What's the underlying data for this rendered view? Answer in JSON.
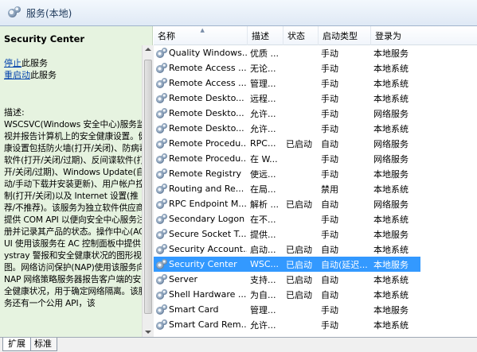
{
  "window": {
    "title": "服务(本地)"
  },
  "left_pane": {
    "service_name": "Security Center",
    "actions": [
      {
        "link": "停止",
        "suffix": "此服务"
      },
      {
        "link": "重启动",
        "suffix": "此服务"
      }
    ],
    "description_label": "描述:",
    "description": "WSCSVC(Windows 安全中心)服务监视并报告计算机上的安全健康设置。健康设置包括防火墙(打开/关闭)、防病毒软件(打开/关闭/过期)、反间谍软件(打开/关闭/过期)、Windows Update(自动/手动下载并安装更新)、用户帐户控制(打开/关闭)以及 Internet 设置(推荐/不推荐)。该服务为独立软件供应商提供 COM API 以便向安全中心服务注册并记录其产品的状态。操作中心(AC) UI 使用该服务在 AC 控制面板中提供 systray 警报和安全健康状况的图形视图。网络访问保护(NAP)使用该服务向 NAP 网络策略服务器报告客户端的安全健康状况，用于确定网络隔离。该服务还有一个公用 API，该"
  },
  "grid": {
    "columns": [
      "名称",
      "描述",
      "状态",
      "启动类型",
      "登录为"
    ],
    "rows": [
      {
        "name": "Quality Windows...",
        "desc": "优质 ...",
        "status": "",
        "start": "手动",
        "logon": "本地服务"
      },
      {
        "name": "Remote Access ...",
        "desc": "无论...",
        "status": "",
        "start": "手动",
        "logon": "本地系统"
      },
      {
        "name": "Remote Access ...",
        "desc": "管理...",
        "status": "",
        "start": "手动",
        "logon": "本地系统"
      },
      {
        "name": "Remote Deskto...",
        "desc": "远程...",
        "status": "",
        "start": "手动",
        "logon": "本地系统"
      },
      {
        "name": "Remote Deskto...",
        "desc": "允许...",
        "status": "",
        "start": "手动",
        "logon": "网络服务"
      },
      {
        "name": "Remote Deskto...",
        "desc": "允许...",
        "status": "",
        "start": "手动",
        "logon": "本地系统"
      },
      {
        "name": "Remote Procedu...",
        "desc": "RPC...",
        "status": "已启动",
        "start": "自动",
        "logon": "网络服务"
      },
      {
        "name": "Remote Procedu...",
        "desc": "在 W...",
        "status": "",
        "start": "手动",
        "logon": "网络服务"
      },
      {
        "name": "Remote Registry",
        "desc": "使远...",
        "status": "",
        "start": "手动",
        "logon": "本地服务"
      },
      {
        "name": "Routing and Re...",
        "desc": "在局...",
        "status": "",
        "start": "禁用",
        "logon": "本地系统"
      },
      {
        "name": "RPC Endpoint M...",
        "desc": "解析 ...",
        "status": "已启动",
        "start": "自动",
        "logon": "网络服务"
      },
      {
        "name": "Secondary Logon",
        "desc": "在不...",
        "status": "",
        "start": "手动",
        "logon": "本地系统"
      },
      {
        "name": "Secure Socket T...",
        "desc": "提供...",
        "status": "",
        "start": "手动",
        "logon": "本地服务"
      },
      {
        "name": "Security Account...",
        "desc": "启动...",
        "status": "已启动",
        "start": "自动",
        "logon": "本地系统"
      },
      {
        "name": "Security Center",
        "desc": "WSC...",
        "status": "已启动",
        "start": "自动(延迟...",
        "logon": "本地服务"
      },
      {
        "name": "Server",
        "desc": "支持...",
        "status": "已启动",
        "start": "自动",
        "logon": "本地系统"
      },
      {
        "name": "Shell Hardware ...",
        "desc": "为自...",
        "status": "已启动",
        "start": "自动",
        "logon": "本地系统"
      },
      {
        "name": "Smart Card",
        "desc": "管理...",
        "status": "",
        "start": "手动",
        "logon": "本地服务"
      },
      {
        "name": "Smart Card Rem...",
        "desc": "允许...",
        "status": "",
        "start": "手动",
        "logon": "本地系统"
      }
    ]
  },
  "tabs": [
    "扩展",
    "标准"
  ],
  "colors": {
    "selected_row": "#3399ff",
    "left_pane_bg": "#e6f3e0",
    "link": "#0645ad"
  }
}
